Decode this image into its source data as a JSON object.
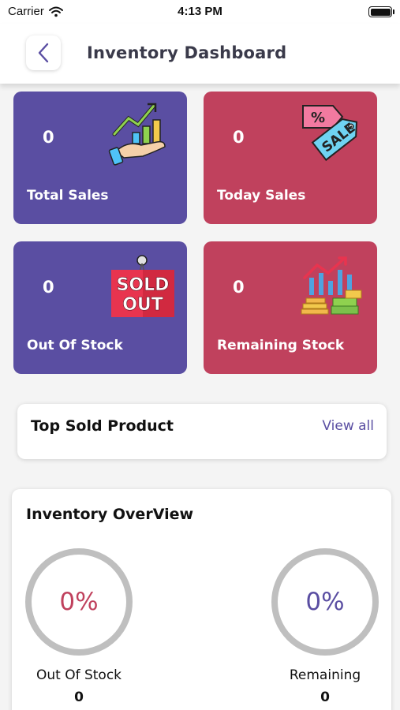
{
  "status_bar": {
    "carrier": "Carrier",
    "time": "4:13 PM"
  },
  "header": {
    "title": "Inventory Dashboard"
  },
  "cards": [
    {
      "value": "0",
      "label": "Total Sales",
      "color": "#5a4ea2",
      "icon": "sales-growth-chart-icon"
    },
    {
      "value": "0",
      "label": "Today Sales",
      "color": "#c0415d",
      "icon": "sale-tag-icon"
    },
    {
      "value": "0",
      "label": "Out Of Stock",
      "color": "#5a4ea2",
      "icon": "sold-out-sign-icon"
    },
    {
      "value": "0",
      "label": "Remaining Stock",
      "color": "#c0415d",
      "icon": "money-growth-chart-icon"
    }
  ],
  "sold_out_sign": {
    "line1": "SOLD",
    "line2": "OUT"
  },
  "sale_tag": {
    "percent": "%",
    "text": "SALE"
  },
  "top_sold": {
    "title": "Top Sold Product",
    "view_all": "View all"
  },
  "overview": {
    "title": "Inventory OverView",
    "out_of_stock": {
      "percent": "0%",
      "label": "Out Of Stock",
      "value": "0"
    },
    "remaining": {
      "percent": "0%",
      "label": "Remaining",
      "value": "0"
    }
  }
}
